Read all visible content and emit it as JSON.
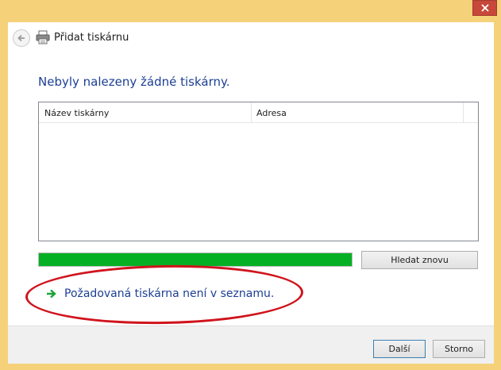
{
  "window": {
    "title": "Přidat tiskárnu",
    "close_label": "✕",
    "accent_color": "#f5d27a",
    "close_color": "#c7473b"
  },
  "header": {
    "back_icon": "back-arrow-icon",
    "printer_icon": "printer-icon"
  },
  "main": {
    "heading": "Nebyly nalezeny žádné tiskárny.",
    "list": {
      "columns": [
        "Název tiskárny",
        "Adresa"
      ],
      "rows": []
    },
    "progress": {
      "value_percent": 100,
      "color": "#06b025"
    },
    "search_again_label": "Hledat znovu",
    "missing_printer_link": "Požadovaná tiskárna není v seznamu.",
    "link_icon": "green-arrow-icon",
    "annotation_color": "#d0141d"
  },
  "footer": {
    "next_label": "Další",
    "cancel_label": "Storno"
  }
}
